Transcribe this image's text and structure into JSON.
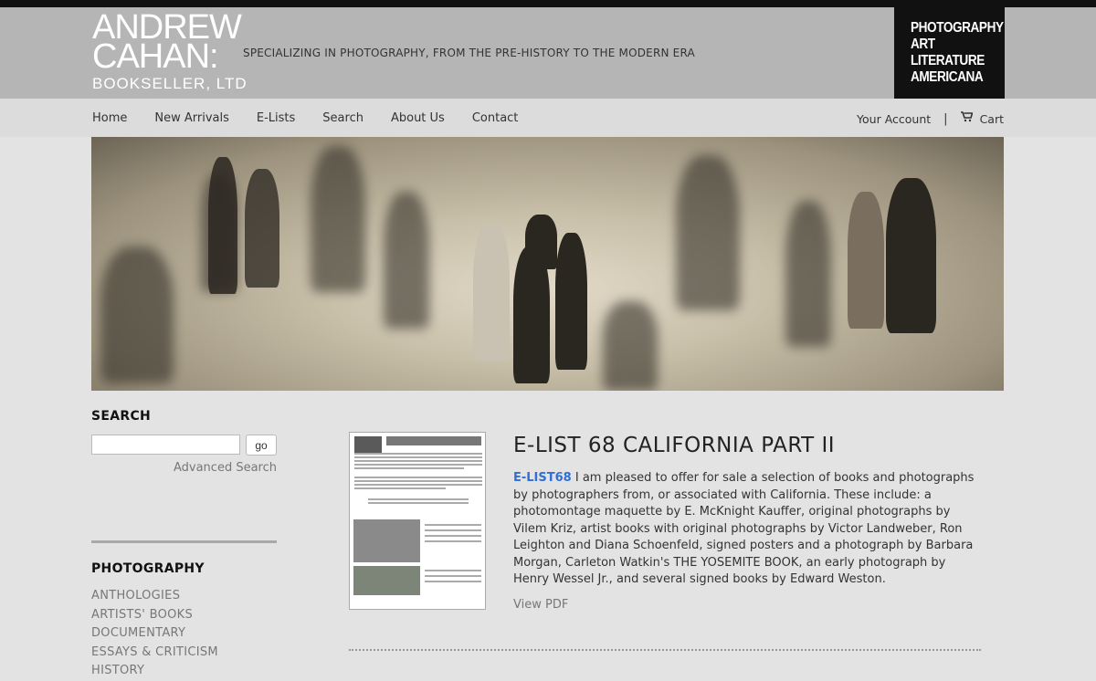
{
  "logo": {
    "line1": "ANDREW",
    "line2": "CAHAN:",
    "line3": "BOOKSELLER, LTD"
  },
  "tagline": "SPECIALIZING IN PHOTOGRAPHY, FROM THE PRE-HISTORY TO THE MODERN ERA",
  "categories": [
    "PHOTOGRAPHY",
    "ART",
    "LITERATURE",
    "AMERICANA"
  ],
  "nav": {
    "items": [
      "Home",
      "New Arrivals",
      "E-Lists",
      "Search",
      "About Us",
      "Contact"
    ],
    "account": "Your Account",
    "separator": "|",
    "cart": "Cart"
  },
  "sidebar": {
    "search_heading": "SEARCH",
    "search_value": "",
    "go_label": "go",
    "advanced": "Advanced Search",
    "photo_heading": "PHOTOGRAPHY",
    "photo_items": [
      "ANTHOLOGIES",
      "ARTISTS' BOOKS",
      "DOCUMENTARY",
      "ESSAYS & CRITICISM",
      "HISTORY"
    ]
  },
  "elist": {
    "title": "E-LIST 68 CALIFORNIA PART II",
    "code": "E-LIST68",
    "body": " I am pleased to offer for sale a selection of books and photographs by photographers from, or associated with California.  These include: a photomontage maquette by E. McKnight Kauffer, original photographs by Vilem Kriz, artist books with original photographs by Victor Landweber, Ron Leighton and Diana Schoenfeld, signed posters and a photograph by Barbara Morgan, Carleton Watkin's THE YOSEMITE BOOK, an early photograph by Henry Wessel Jr., and several signed books by Edward Weston.",
    "view_pdf": "View PDF"
  },
  "colors": {
    "link": "#2f6fd6",
    "header_bg": "#b5b5b5",
    "nav_bg": "#dcdcdc",
    "page_bg": "#e3e3e3"
  }
}
